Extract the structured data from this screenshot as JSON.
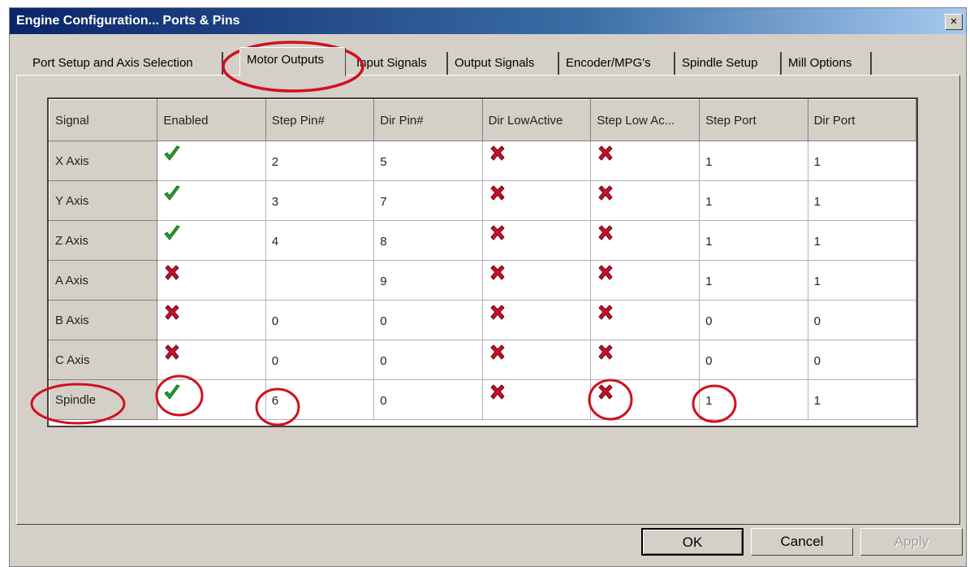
{
  "window": {
    "title": "Engine Configuration... Ports & Pins",
    "close_label": "×"
  },
  "tabs": [
    {
      "label": "Port Setup and Axis Selection",
      "active": false
    },
    {
      "label": "Motor Outputs",
      "active": true
    },
    {
      "label": "Input Signals",
      "active": false
    },
    {
      "label": "Output Signals",
      "active": false
    },
    {
      "label": "Encoder/MPG's",
      "active": false
    },
    {
      "label": "Spindle Setup",
      "active": false
    },
    {
      "label": "Mill Options",
      "active": false
    }
  ],
  "table": {
    "columns": [
      "Signal",
      "Enabled",
      "Step Pin#",
      "Dir Pin#",
      "Dir LowActive",
      "Step Low Ac...",
      "Step Port",
      "Dir Port"
    ],
    "rows": [
      {
        "signal": "X Axis",
        "enabled": true,
        "step_pin": "2",
        "dir_pin": "5",
        "dir_low_active": false,
        "step_low_active": false,
        "step_port": "1",
        "dir_port": "1"
      },
      {
        "signal": "Y Axis",
        "enabled": true,
        "step_pin": "3",
        "dir_pin": "7",
        "dir_low_active": false,
        "step_low_active": false,
        "step_port": "1",
        "dir_port": "1"
      },
      {
        "signal": "Z Axis",
        "enabled": true,
        "step_pin": "4",
        "dir_pin": "8",
        "dir_low_active": false,
        "step_low_active": false,
        "step_port": "1",
        "dir_port": "1"
      },
      {
        "signal": "A Axis",
        "enabled": false,
        "step_pin": "",
        "dir_pin": "9",
        "dir_low_active": false,
        "step_low_active": false,
        "step_port": "1",
        "dir_port": "1"
      },
      {
        "signal": "B Axis",
        "enabled": false,
        "step_pin": "0",
        "dir_pin": "0",
        "dir_low_active": false,
        "step_low_active": false,
        "step_port": "0",
        "dir_port": "0"
      },
      {
        "signal": "C Axis",
        "enabled": false,
        "step_pin": "0",
        "dir_pin": "0",
        "dir_low_active": false,
        "step_low_active": false,
        "step_port": "0",
        "dir_port": "0"
      },
      {
        "signal": "Spindle",
        "enabled": true,
        "step_pin": "6",
        "dir_pin": "0",
        "dir_low_active": false,
        "step_low_active": false,
        "step_port": "1",
        "dir_port": "1"
      }
    ]
  },
  "buttons": {
    "ok": "OK",
    "cancel": "Cancel",
    "apply": "Apply"
  },
  "icons": {
    "checked": "green-check-icon",
    "unchecked": "red-x-icon"
  },
  "colors": {
    "title_bar": "#0a246a",
    "dialog_bg": "#d4d0c8",
    "check": "#22a22e",
    "cross": "#c8102e",
    "annotation": "#d01020"
  }
}
